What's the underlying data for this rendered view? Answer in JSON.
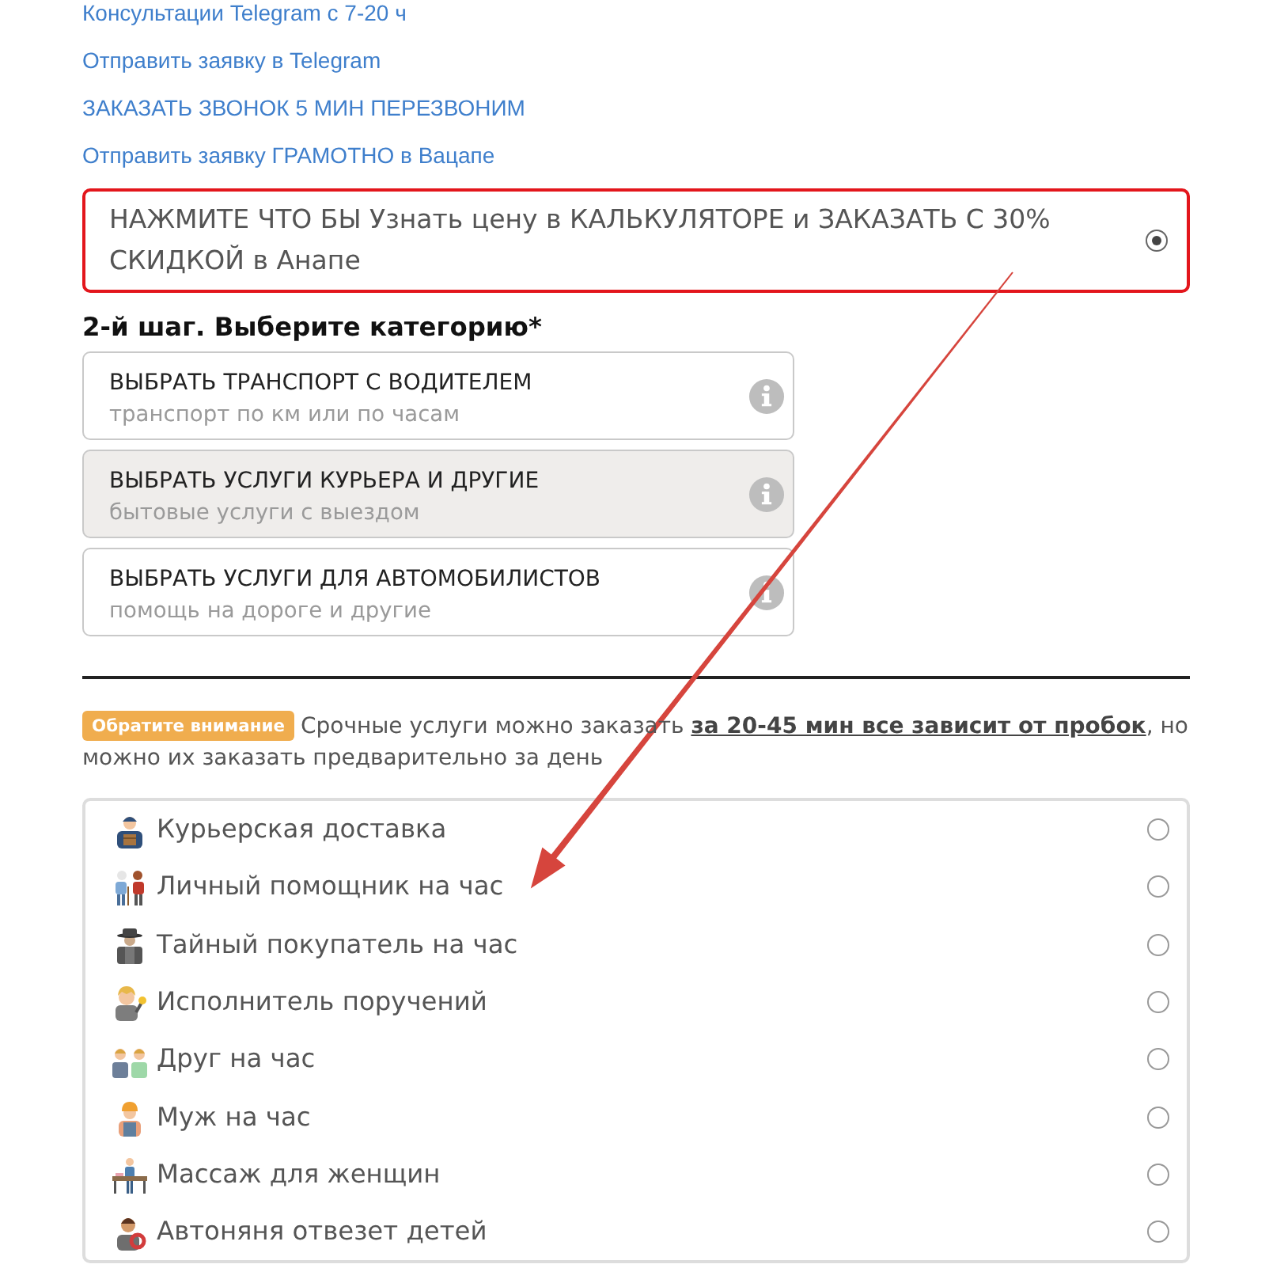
{
  "links": [
    {
      "text": "Консультации Telegram с 7-20 ч"
    },
    {
      "text": "Отправить заявку в Telegram"
    },
    {
      "text": "ЗАКАЗАТЬ ЗВОНОК 5 МИН ПЕРЕЗВОНИМ"
    },
    {
      "text": "Отправить заявку ГРАМОТНО в Вацапе"
    }
  ],
  "calculator_option": {
    "label": "НАЖМИТЕ ЧТО БЫ Узнать цену в КАЛЬКУЛЯТОРЕ и ЗАКАЗАТЬ С 30% СКИДКОЙ в Анапе",
    "selected": true
  },
  "step_2": {
    "heading": "2-й шаг. Выберите категорию*",
    "categories": [
      {
        "title": "ВЫБРАТЬ ТРАНСПОРТ С ВОДИТЕЛЕМ",
        "subtitle": "транспорт по км или по часам",
        "selected": false
      },
      {
        "title": "ВЫБРАТЬ УСЛУГИ КУРЬЕРА И ДРУГИЕ",
        "subtitle": "бытовые услуги с выездом",
        "selected": true
      },
      {
        "title": "ВЫБРАТЬ УСЛУГИ ДЛЯ АВТОМОБИЛИСТОВ",
        "subtitle": "помощь на дороге и другие",
        "selected": false
      }
    ]
  },
  "notice": {
    "badge": "Обратите внимание",
    "text": "Срочные услуги можно заказать **за 20-45 мин все зависит от пробок**, но можно их заказать предварительно за день"
  },
  "services": [
    {
      "label": "Курьерская доставка",
      "selected": false
    },
    {
      "label": "Личный помощник на час",
      "selected": false
    },
    {
      "label": "Тайный покупатель на час",
      "selected": false
    },
    {
      "label": "Исполнитель поручений",
      "selected": false
    },
    {
      "label": "Друг на час",
      "selected": false
    },
    {
      "label": "Муж на час",
      "selected": false
    },
    {
      "label": "Массаж для женщин",
      "selected": false
    },
    {
      "label": "Автоняня отвезет детей",
      "selected": false
    }
  ]
}
